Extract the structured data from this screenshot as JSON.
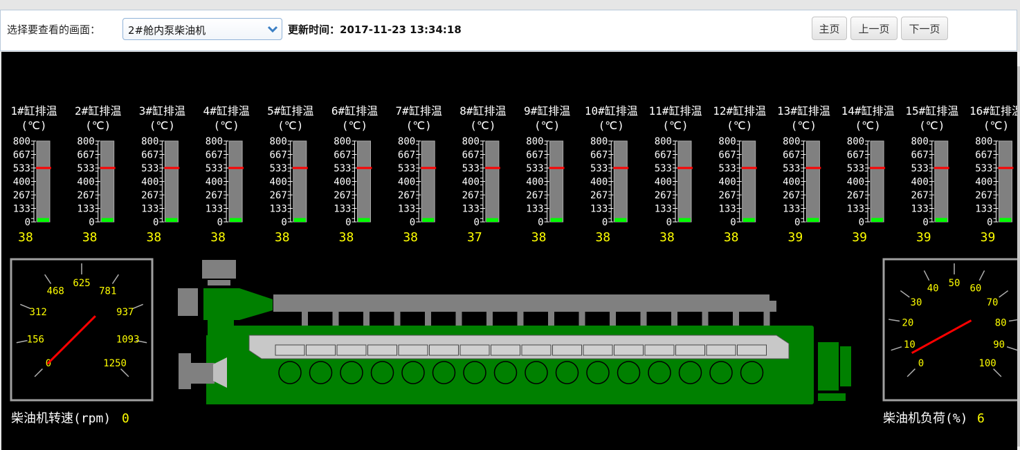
{
  "header": {
    "select_label": "选择要查看的画面：",
    "select_value": "2#舱内泵柴油机",
    "update_time": "更新时间：2017-11-23 13:34:18",
    "nav": {
      "home": "主页",
      "prev": "上一页",
      "next": "下一页"
    }
  },
  "gauges": {
    "scale_labels": [
      "800",
      "667",
      "533",
      "400",
      "267",
      "133",
      "0"
    ],
    "unit": "(℃)",
    "alarm_value": 533,
    "max_value": 800,
    "items": [
      {
        "label": "1#缸排温",
        "value": "38"
      },
      {
        "label": "2#缸排温",
        "value": "38"
      },
      {
        "label": "3#缸排温",
        "value": "38"
      },
      {
        "label": "4#缸排温",
        "value": "38"
      },
      {
        "label": "5#缸排温",
        "value": "38"
      },
      {
        "label": "6#缸排温",
        "value": "38"
      },
      {
        "label": "7#缸排温",
        "value": "38"
      },
      {
        "label": "8#缸排温",
        "value": "37"
      },
      {
        "label": "9#缸排温",
        "value": "38"
      },
      {
        "label": "10#缸排温",
        "value": "38"
      },
      {
        "label": "11#缸排温",
        "value": "38"
      },
      {
        "label": "12#缸排温",
        "value": "38"
      },
      {
        "label": "13#缸排温",
        "value": "39"
      },
      {
        "label": "14#缸排温",
        "value": "39"
      },
      {
        "label": "15#缸排温",
        "value": "39"
      },
      {
        "label": "16#缸排温",
        "value": "39"
      }
    ]
  },
  "rpm_dial": {
    "label": "柴油机转速(rpm)",
    "value": "0",
    "ticks": [
      "0",
      "156",
      "312",
      "468",
      "625",
      "781",
      "937",
      "1093",
      "1250"
    ]
  },
  "load_dial": {
    "label": "柴油机负荷(%)",
    "value": "6",
    "ticks": [
      "0",
      "10",
      "20",
      "30",
      "40",
      "50",
      "60",
      "70",
      "80",
      "90",
      "100"
    ]
  },
  "engine": {
    "cylinder_count": 16,
    "colors": {
      "body": "#008000",
      "casing": "#808080",
      "alarm": "#ff0000",
      "value": "#ffff00",
      "level": "#00ff00"
    }
  }
}
